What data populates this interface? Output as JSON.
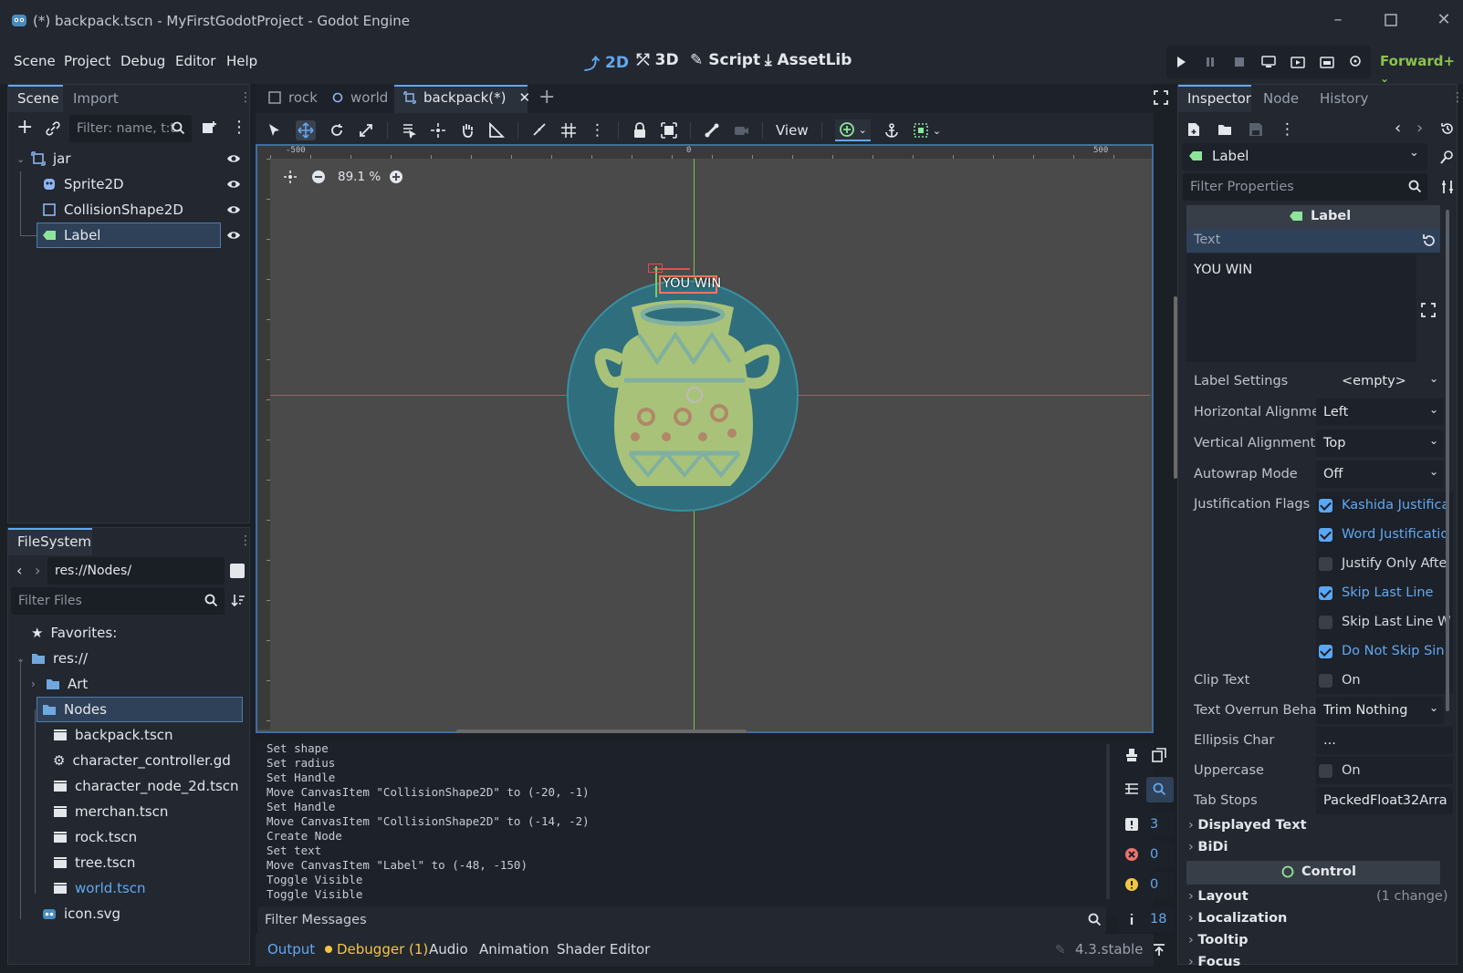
{
  "window": {
    "title": "(*) backpack.tscn - MyFirstGodotProject - Godot Engine",
    "controls": [
      "minimize",
      "maximize",
      "close"
    ]
  },
  "menubar": {
    "items": [
      "Scene",
      "Project",
      "Debug",
      "Editor",
      "Help"
    ],
    "workspaces": [
      {
        "label": "2D",
        "icon": "2d-icon",
        "active": true
      },
      {
        "label": "3D",
        "icon": "3d-icon",
        "active": false
      },
      {
        "label": "Script",
        "icon": "script-icon",
        "active": false
      },
      {
        "label": "AssetLib",
        "icon": "assetlib-icon",
        "active": false
      }
    ],
    "renderer": "Forward+"
  },
  "scene_dock": {
    "tabs": [
      "Scene",
      "Import"
    ],
    "filter_placeholder": "Filter: name, t:t",
    "tree": [
      {
        "label": "jar",
        "icon": "node2d-icon",
        "depth": 0
      },
      {
        "label": "Sprite2D",
        "icon": "sprite2d-icon",
        "depth": 1
      },
      {
        "label": "CollisionShape2D",
        "icon": "collisionshape-icon",
        "depth": 1
      },
      {
        "label": "Label",
        "icon": "label-icon",
        "depth": 1,
        "selected": true
      }
    ]
  },
  "filesystem_dock": {
    "title": "FileSystem",
    "path": "res://Nodes/",
    "filter_placeholder": "Filter Files",
    "favorites_label": "Favorites:",
    "root": "res://",
    "folders": [
      "Art",
      "Nodes"
    ],
    "files": [
      {
        "label": "backpack.tscn",
        "icon": "scene-icon"
      },
      {
        "label": "character_controller.gd",
        "icon": "gear-icon"
      },
      {
        "label": "character_node_2d.tscn",
        "icon": "scene-icon"
      },
      {
        "label": "merchan.tscn",
        "icon": "scene-icon"
      },
      {
        "label": "rock.tscn",
        "icon": "scene-icon"
      },
      {
        "label": "tree.tscn",
        "icon": "scene-icon"
      },
      {
        "label": "world.tscn",
        "icon": "scene-icon",
        "highlight": true
      }
    ],
    "root_files": [
      {
        "label": "icon.svg",
        "icon": "godot-icon"
      }
    ]
  },
  "editor_tabs": [
    {
      "label": "rock",
      "icon": "scene-tab-icon"
    },
    {
      "label": "world",
      "icon": "circle-icon"
    },
    {
      "label": "backpack(*)",
      "icon": "scene-tab-icon",
      "active": true
    }
  ],
  "toolbar": {
    "view_label": "View"
  },
  "viewport": {
    "zoom": "89.1 %",
    "ruler_labels": [
      "-500",
      "0",
      "500"
    ],
    "label_text": "YOU WIN",
    "colors": {
      "background": "#4a4a4a",
      "circle": "#2f6e7c",
      "jar": "#a9c27a"
    }
  },
  "output": {
    "lines": [
      "Set shape",
      "Set radius",
      "Set Handle",
      "Move CanvasItem \"CollisionShape2D\" to (-20, -1)",
      "Set Handle",
      "Move CanvasItem \"CollisionShape2D\" to (-14, -2)",
      "Create Node",
      "Set text",
      "Move CanvasItem \"Label\" to (-48, -150)",
      "Toggle Visible",
      "Toggle Visible"
    ],
    "filter_placeholder": "Filter Messages",
    "counters": [
      {
        "icon": "message-icon",
        "value": "3"
      },
      {
        "icon": "error-icon",
        "value": "0"
      },
      {
        "icon": "warning-icon",
        "value": "0"
      },
      {
        "icon": "info-icon",
        "value": "18"
      }
    ]
  },
  "bottom_bar": {
    "tabs": [
      "Output",
      "Debugger (1)",
      "Audio",
      "Animation",
      "Shader Editor"
    ],
    "version": "4.3.stable"
  },
  "inspector": {
    "tabs": [
      "Inspector",
      "Node",
      "History"
    ],
    "node_type": "Label",
    "filter_placeholder": "Filter Properties",
    "class_header": "Label",
    "text_label": "Text",
    "text_value": "YOU WIN",
    "properties": [
      {
        "label": "Label Settings",
        "value": "<empty>"
      },
      {
        "label": "Horizontal Alignme",
        "value": "Left"
      },
      {
        "label": "Vertical Alignment",
        "value": "Top"
      },
      {
        "label": "Autowrap Mode",
        "value": "Off"
      }
    ],
    "justification_label": "Justification Flags",
    "flags": [
      {
        "label": "Kashida Justifica",
        "checked": true
      },
      {
        "label": "Word Justificatio",
        "checked": true
      },
      {
        "label": "Justify Only Afte",
        "checked": false
      },
      {
        "label": "Skip Last Line",
        "checked": true
      },
      {
        "label": "Skip Last Line W",
        "checked": false
      },
      {
        "label": "Do Not Skip Sin",
        "checked": true
      }
    ],
    "clip_text": {
      "label": "Clip Text",
      "value": "On"
    },
    "overrun": {
      "label": "Text Overrun Behav",
      "value": "Trim Nothing"
    },
    "ellipsis": {
      "label": "Ellipsis Char",
      "value": "..."
    },
    "uppercase": {
      "label": "Uppercase",
      "value": "On"
    },
    "tab_stops": {
      "label": "Tab Stops",
      "value": "PackedFloat32Arra"
    },
    "sections": [
      "Displayed Text",
      "BiDi"
    ],
    "control_header": "Control",
    "control_sections": [
      "Layout",
      "Localization",
      "Tooltip",
      "Focus"
    ],
    "layout_changes": "(1 change)"
  }
}
